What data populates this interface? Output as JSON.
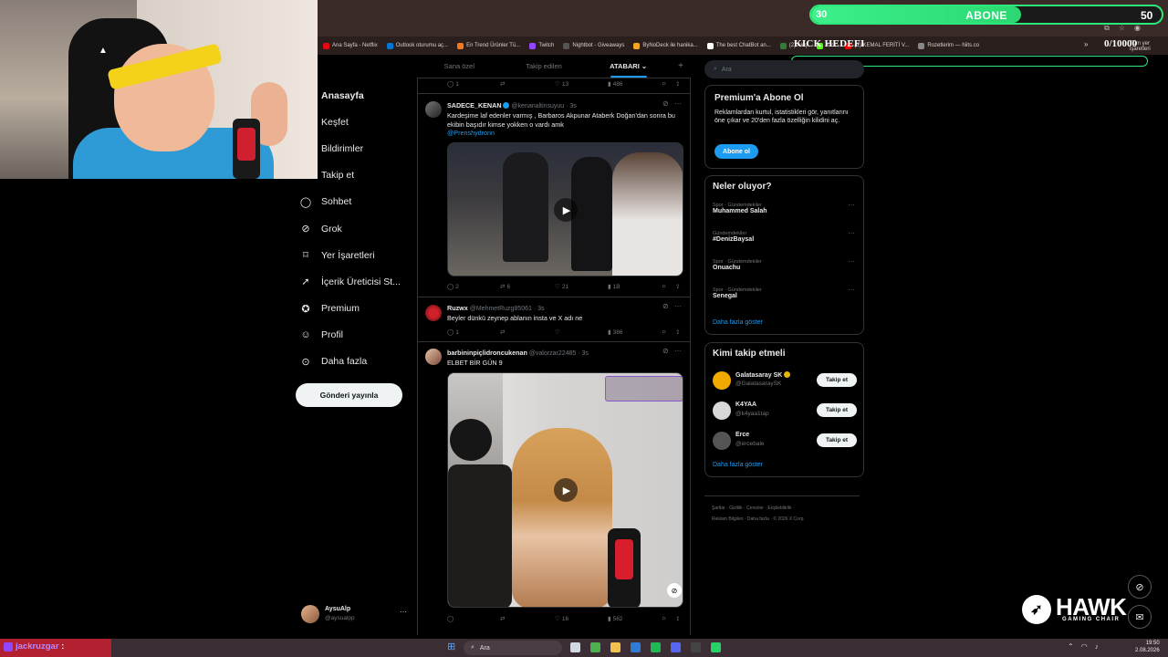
{
  "browser": {
    "bookmarks": [
      {
        "label": "Ana Sayfa - Netflix",
        "color": "#e50914"
      },
      {
        "label": "Outlook oturumu aç...",
        "color": "#0078d4"
      },
      {
        "label": "En Trend Ürünler Tü...",
        "color": "#f27a1a"
      },
      {
        "label": "Twitch",
        "color": "#9146ff"
      },
      {
        "label": "Nightbot - Giveaways",
        "color": "#555555"
      },
      {
        "label": "ByNoDeck ile hanika...",
        "color": "#f5a623"
      },
      {
        "label": "The best ChatBot an...",
        "color": "#ffffff"
      },
      {
        "label": "(2) Akış",
        "color": "#2e7d32"
      },
      {
        "label": "Kick",
        "color": "#53fc18"
      },
      {
        "label": "(1) KEMAL FERİTİ V...",
        "color": "#ff0000"
      },
      {
        "label": "Rozetlerim — hiits.co",
        "color": "#888888"
      }
    ],
    "more_bookmarks": "»",
    "other_bookmarks": "Tüm yer işaretleri"
  },
  "overlay": {
    "goal_start": "30",
    "goal_label": "ABONE",
    "goal_end": "50",
    "goal_progress": 0.6,
    "kick_title": "KICK HEDEFI",
    "kick_count": "0/10000"
  },
  "nav": {
    "items": [
      {
        "label": "Anasayfa",
        "icon": "home-icon",
        "glyph": "",
        "active": true
      },
      {
        "label": "Keşfet",
        "icon": "search-icon",
        "glyph": "",
        "active": false
      },
      {
        "label": "Bildirimler",
        "icon": "bell-icon",
        "glyph": "",
        "active": false
      },
      {
        "label": "Takip et",
        "icon": "follow-icon",
        "glyph": "",
        "active": false
      },
      {
        "label": "Sohbet",
        "icon": "chat-icon",
        "glyph": "◯",
        "active": false
      },
      {
        "label": "Grok",
        "icon": "grok-icon",
        "glyph": "⊘",
        "active": false
      },
      {
        "label": "Yer İşaretleri",
        "icon": "bookmark-icon",
        "glyph": "⌑",
        "active": false
      },
      {
        "label": "İçerik Üreticisi St...",
        "icon": "rocket-icon",
        "glyph": "➚",
        "active": false
      },
      {
        "label": "Premium",
        "icon": "premium-icon",
        "glyph": "✪",
        "active": false
      },
      {
        "label": "Profil",
        "icon": "profile-icon",
        "glyph": "☺",
        "active": false
      },
      {
        "label": "Daha fazla",
        "icon": "more-circle-icon",
        "glyph": "⊙",
        "active": false
      }
    ],
    "post_button": "Gönderi yayınla",
    "account": {
      "name": "AysuAlp",
      "handle": "@aysualpp",
      "menu": "···"
    }
  },
  "timeline": {
    "tabs": [
      "Sana özel",
      "Takip edilen",
      "ATABARI"
    ],
    "tab_chevron": "⌄",
    "tab_plus": "+",
    "top_actions": {
      "replies": "1",
      "reposts": "",
      "likes": "13",
      "views": "486"
    },
    "tweets": [
      {
        "name": "SADECE_KENAN",
        "handle": "@kenanaltinsuyuu · 3s",
        "text": "Kardeşime laf edenler varmış , Barbaros Akpunar Ataberk Doğan'dan sonra bu ekibin başıdır kimse yokken o vardı amk",
        "mention": "@Prenshydronn",
        "replies": "2",
        "reposts": "6",
        "likes": "21",
        "views": "1B"
      },
      {
        "name": "Ruzwx",
        "handle": "@MehmetRuzg85061 · 3s",
        "text": "Beyler dünkü zeynep ablanın insta ve X adı ne",
        "replies": "1",
        "reposts": "",
        "likes": "",
        "views": "386"
      },
      {
        "name": "barbininpiçlidroncukenan",
        "handle": "@valorzar22485 · 3s",
        "text": "ELBET BİR GÜN 9",
        "replies": "",
        "reposts": "",
        "likes": "16",
        "views": "562"
      }
    ]
  },
  "right": {
    "search_placeholder": "Ara",
    "premium": {
      "title": "Premium'a Abone Ol",
      "text": "Reklamlardan kurtul, istatistikleri gör, yanıtlarını öne çıkar ve 20'den fazla özelliğin kilidini aç.",
      "button": "Abone ol"
    },
    "trends": {
      "title": "Neler oluyor?",
      "items": [
        {
          "meta": "Spor · Gündemdekiler",
          "name": "Muhammed Salah"
        },
        {
          "meta": "Gündemdekiler",
          "name": "#DenizBaysal"
        },
        {
          "meta": "Spor · Gündemdekiler",
          "name": "Onuachu"
        },
        {
          "meta": "Spor · Gündemdekiler",
          "name": "Senegal"
        }
      ],
      "more": "Daha fazla göster"
    },
    "who_to_follow": {
      "title": "Kimi takip etmeli",
      "items": [
        {
          "name": "Galatasaray SK",
          "handle": "@GalatasaraySK",
          "button": "Takip et",
          "color": "#f2a900"
        },
        {
          "name": "K4YAA",
          "handle": "@k4yaa1tap",
          "button": "Takip et",
          "color": "#d8d8d8"
        },
        {
          "name": "Erce",
          "handle": "@ercebale",
          "button": "Takip et",
          "color": "#555555"
        }
      ],
      "more": "Daha fazla göster"
    },
    "footer": {
      "line1": "Şartlar · Gizlilik · Çerezler · Erişilebilirlik ·",
      "line2": "Reklam Bilgileri · Daha fazla · © 2026 X Corp."
    }
  },
  "hawk": {
    "word": "HAWK",
    "sub": "GAMING CHAIR"
  },
  "taskbar": {
    "chat_user": "jackruzgar",
    "chat_sep": ":",
    "search": "Ara",
    "time": "19:50",
    "date": "2.08.2026"
  }
}
